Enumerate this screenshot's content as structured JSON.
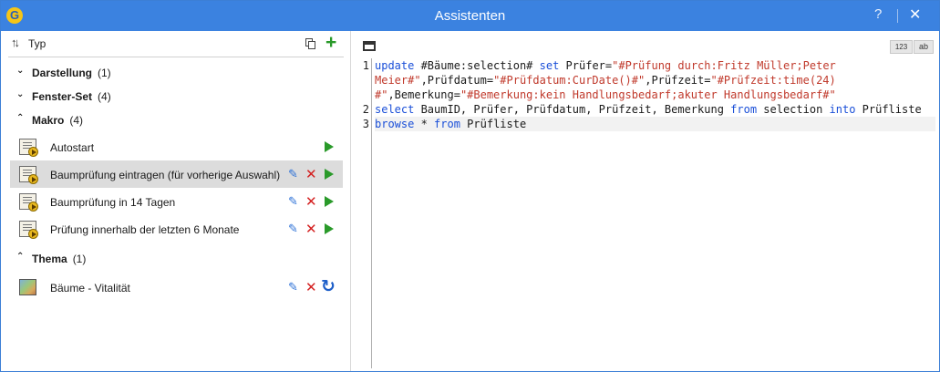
{
  "window": {
    "title": "Assistenten",
    "logo_letter": "G",
    "help_label": "?",
    "close_label": "✕"
  },
  "left_toolbar": {
    "sort_icon": "sort-updown-icon",
    "sort_label": "Typ",
    "copy_icon": "copy-icon",
    "add_icon": "plus-icon"
  },
  "groups": [
    {
      "name": "Darstellung",
      "count": "(1)",
      "expanded": false
    },
    {
      "name": "Fenster-Set",
      "count": "(4)",
      "expanded": false
    },
    {
      "name": "Makro",
      "count": "(4)",
      "expanded": true
    },
    {
      "name": "Thema",
      "count": "(1)",
      "expanded": true
    }
  ],
  "macros": [
    {
      "label": "Autostart",
      "selected": false,
      "editable": false
    },
    {
      "label": "Baumprüfung eintragen (für vorherige Auswahl)",
      "selected": true,
      "editable": true
    },
    {
      "label": "Baumprüfung in 14 Tagen",
      "selected": false,
      "editable": true
    },
    {
      "label": "Prüfung innerhalb der letzten 6 Monate",
      "selected": false,
      "editable": true
    }
  ],
  "themes": [
    {
      "label": "Bäume - Vitalität",
      "editable": true
    }
  ],
  "actions": {
    "edit_glyph": "✎",
    "delete_glyph": "✕",
    "refresh_glyph": "↻"
  },
  "editor_toolbar": {
    "panel_icon": "panel-layout-icon",
    "line_numbers_label": "123",
    "wrap_label": "ab"
  },
  "editor": {
    "line_numbers": [
      "1",
      "",
      "",
      "2",
      "3"
    ],
    "lines": [
      [
        {
          "t": "kw",
          "v": "update"
        },
        {
          "t": "tx",
          "v": " #Bäume:selection# "
        },
        {
          "t": "kw",
          "v": "set"
        },
        {
          "t": "tx",
          "v": " Prüfer="
        },
        {
          "t": "str",
          "v": "\"#Prüfung durch:Fritz Müller;Peter"
        }
      ],
      [
        {
          "t": "str",
          "v": "Meier#\""
        },
        {
          "t": "tx",
          "v": ",Prüfdatum="
        },
        {
          "t": "str",
          "v": "\"#Prüfdatum:CurDate()#\""
        },
        {
          "t": "tx",
          "v": ",Prüfzeit="
        },
        {
          "t": "str",
          "v": "\"#Prüfzeit:time(24)"
        }
      ],
      [
        {
          "t": "str",
          "v": "#\""
        },
        {
          "t": "tx",
          "v": ",Bemerkung="
        },
        {
          "t": "str",
          "v": "\"#Bemerkung:kein Handlungsbedarf;akuter Handlungsbedarf#\""
        }
      ],
      [
        {
          "t": "kw",
          "v": "select"
        },
        {
          "t": "tx",
          "v": " BaumID, Prüfer, Prüfdatum, Prüfzeit, Bemerkung "
        },
        {
          "t": "kw",
          "v": "from"
        },
        {
          "t": "tx",
          "v": " selection "
        },
        {
          "t": "kw",
          "v": "into"
        },
        {
          "t": "tx",
          "v": " Prüfliste"
        }
      ],
      [
        {
          "t": "kw",
          "v": "browse"
        },
        {
          "t": "tx",
          "v": " * "
        },
        {
          "t": "kw",
          "v": "from"
        },
        {
          "t": "tx",
          "v": " Prüfliste"
        }
      ]
    ],
    "current_line": 4
  }
}
